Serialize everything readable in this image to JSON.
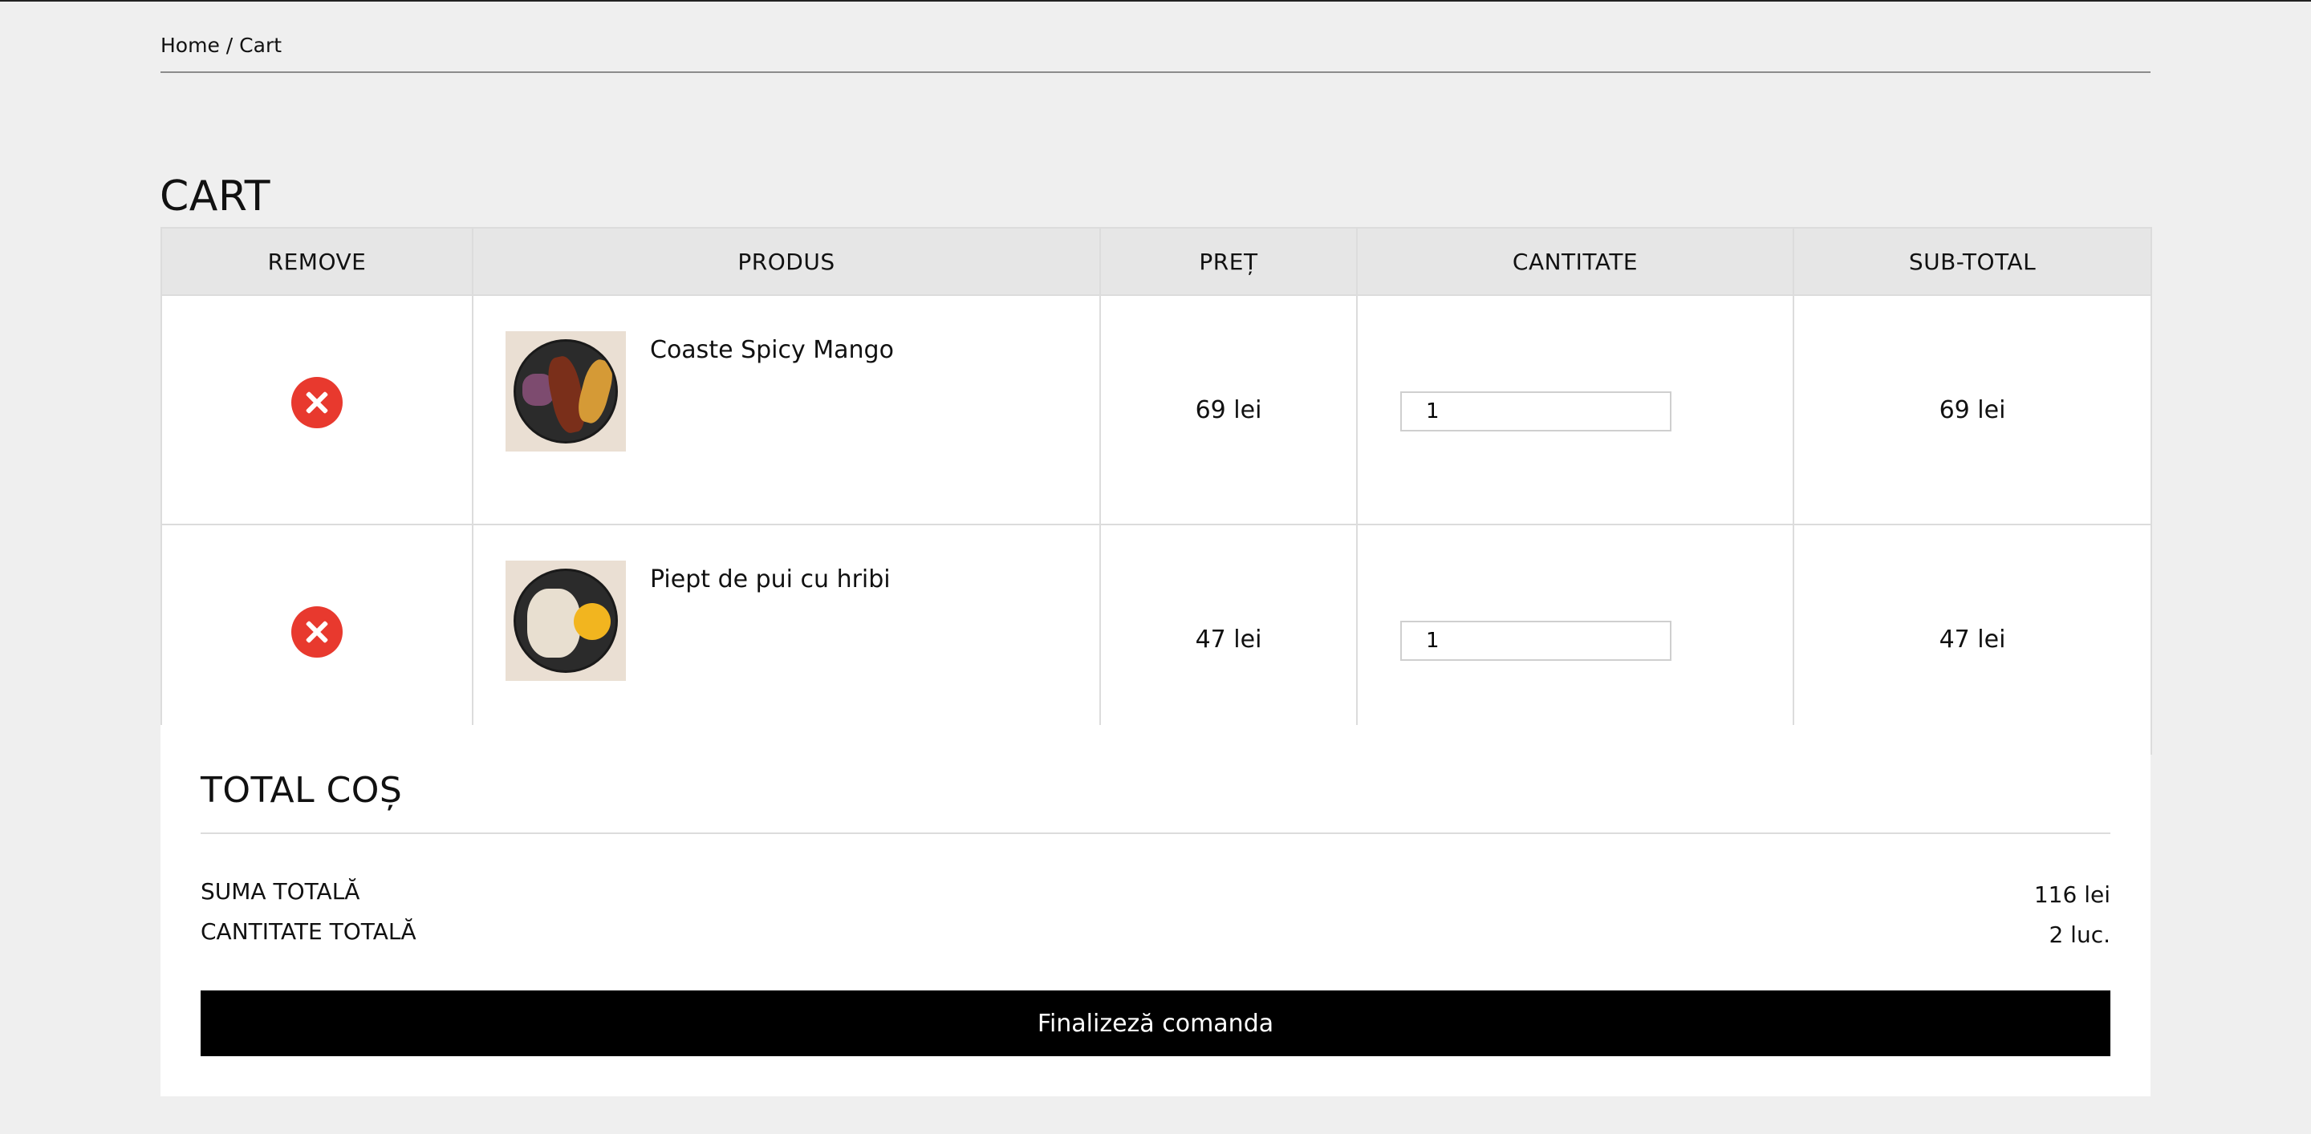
{
  "breadcrumb": {
    "home": "Home",
    "separator": "/",
    "current": "Cart"
  },
  "page_title": "CART",
  "table": {
    "headers": [
      "REMOVE",
      "PRODUS",
      "PREȚ",
      "CANTITATE",
      "SUB-TOTAL"
    ],
    "rows": [
      {
        "name": "Coaste Spicy Mango",
        "price": "69 lei",
        "quantity": "1",
        "subtotal": "69 lei",
        "image_icon": "ribs-with-fries-plate-icon"
      },
      {
        "name": "Piept de pui cu hribi",
        "price": "47 lei",
        "quantity": "1",
        "subtotal": "47 lei",
        "image_icon": "chicken-with-mushrooms-plate-icon"
      }
    ]
  },
  "totals": {
    "title": "TOTAL COȘ",
    "sum_label": "SUMA TOTALĂ",
    "sum_value": "116 lei",
    "qty_label": "CANTITATE TOTALĂ",
    "qty_value": "2 luc.",
    "checkout_label": "Finalizeză comanda"
  },
  "colors": {
    "remove": "#e8392e",
    "background": "#efefef",
    "header_bg": "#e6e6e6",
    "button_bg": "#000000"
  }
}
